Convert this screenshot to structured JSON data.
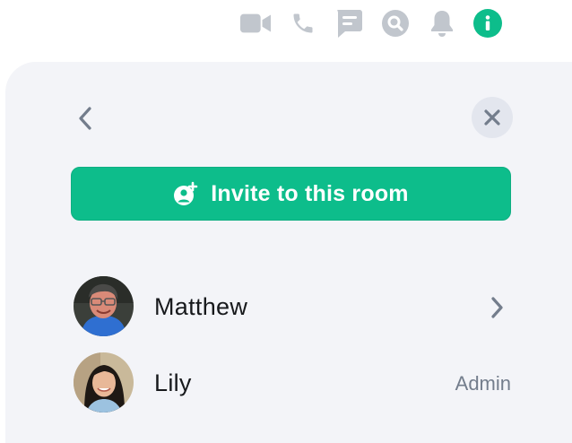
{
  "toolbar": {
    "icons": [
      "video-call-icon",
      "voice-call-icon",
      "threads-icon",
      "search-icon",
      "notifications-icon",
      "room-info-icon"
    ],
    "active_icon": "room-info-icon",
    "active_color": "#0dbd8b",
    "inactive_color": "#c1c6cd"
  },
  "panel": {
    "back_icon": "chevron-left-icon",
    "close_icon": "close-icon",
    "invite_button": {
      "label": "Invite to this room",
      "icon": "invite-user-icon",
      "color": "#0dbd8b"
    }
  },
  "members": [
    {
      "name": "Matthew",
      "role": "",
      "trailing": "chevron-right-icon"
    },
    {
      "name": "Lily",
      "role": "Admin",
      "trailing": ""
    }
  ]
}
